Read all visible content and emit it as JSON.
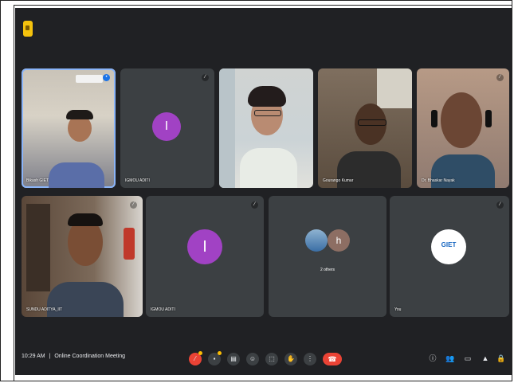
{
  "meeting": {
    "time": "10:29 AM",
    "separator": "|",
    "title": "Online Coordination Meeting"
  },
  "participants": {
    "p1": {
      "name": "Bikash GIET"
    },
    "p2": {
      "name": "IGMOU ADITI",
      "initial": "I"
    },
    "p3": {
      "name": ""
    },
    "p4": {
      "name": "Gourango Kumar"
    },
    "p5": {
      "name": "Dr. Bhaskar Nayak"
    },
    "p6": {
      "name": "SUNDU ADITYA_IIT"
    },
    "p7": {
      "name": "IGMOU ADITI",
      "initial": "I"
    },
    "p8": {
      "name": "2 others",
      "initial": "h"
    },
    "p9": {
      "name": "You",
      "logo_text": "GIET"
    }
  },
  "icons": {
    "mic": "mic-off-icon",
    "cam": "camera-icon",
    "captions": "captions-icon",
    "emoji": "emoji-icon",
    "present": "present-icon",
    "raise": "raise-hand-icon",
    "more": "more-options-icon",
    "end": "end-call-icon",
    "info": "info-icon",
    "people": "people-icon",
    "chat": "chat-icon",
    "activities": "activities-icon",
    "lock": "host-controls-icon"
  },
  "colors": {
    "background": "#202124",
    "tile": "#3c4043",
    "avatar": "#a142c4",
    "end_call": "#ea4335",
    "active_border": "#8ab4f8"
  }
}
